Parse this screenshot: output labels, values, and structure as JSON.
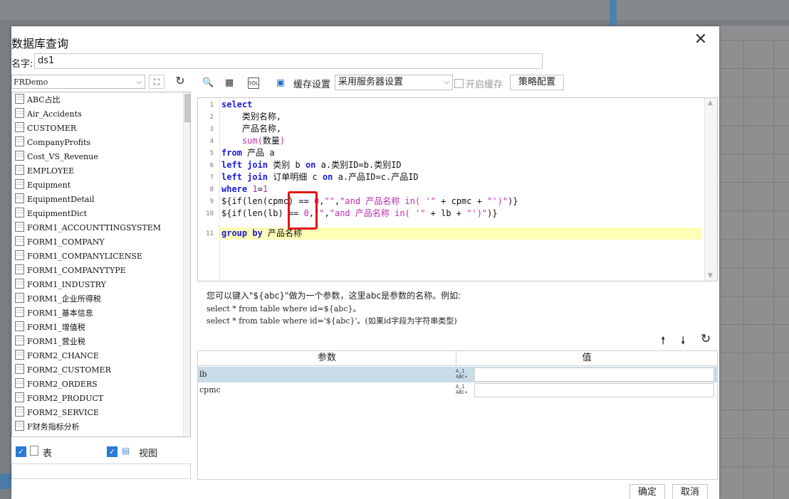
{
  "dialog": {
    "title": "数据库查询",
    "close_glyph": "✕",
    "name_label": "名字:",
    "name_value": "ds1"
  },
  "left": {
    "datasource": "FRDemo",
    "tables": [
      "ABC占比",
      "Air_Accidents",
      "CUSTOMER",
      "CompanyProfits",
      "Cost_VS_Revenue",
      "EMPLOYEE",
      "Equipment",
      "EquipmentDetail",
      "EquipmentDict",
      "FORM1_ACCOUNTTINGSYSTEM",
      "FORM1_COMPANY",
      "FORM1_COMPANYLICENSE",
      "FORM1_COMPANYTYPE",
      "FORM1_INDUSTRY",
      "FORM1_企业所得税",
      "FORM1_基本信息",
      "FORM1_增值税",
      "FORM1_营业税",
      "FORM2_CHANCE",
      "FORM2_CUSTOMER",
      "FORM2_ORDERS",
      "FORM2_PRODUCT",
      "FORM2_SERVICE",
      "F财务指标分析"
    ],
    "filter_table_label": "表",
    "filter_view_label": "视图"
  },
  "toolbar": {
    "cache_label": "缓存设置",
    "cache_option": "采用服务器设置",
    "enable_cache_label": "开启缓存",
    "strategy_button": "策略配置"
  },
  "editor": {
    "line_numbers": [
      "1",
      "2",
      "3",
      "4",
      "5",
      "6",
      "7",
      "8",
      "9",
      "10",
      "11"
    ]
  },
  "help": {
    "line1": "您可以键入\"${abc}\"做为一个参数，这里abc是参数的名称。例如:",
    "line2": "select * from table where id=${abc}。",
    "line3": "select * from table where id='${abc}'。(如果id字段为字符串类型)"
  },
  "params": {
    "header_param": "参数",
    "header_value": "值",
    "rows": [
      {
        "name": "lb",
        "value": ""
      },
      {
        "name": "cpmc",
        "value": ""
      }
    ]
  },
  "footer": {
    "ok": "确定",
    "cancel": "取消"
  },
  "colors": {
    "keyword": "#1a1ae0",
    "function": "#c02ab0",
    "highlight_line": "#fdfdb6",
    "red_annotation": "#e01515",
    "selected_row": "#c9dcea"
  }
}
